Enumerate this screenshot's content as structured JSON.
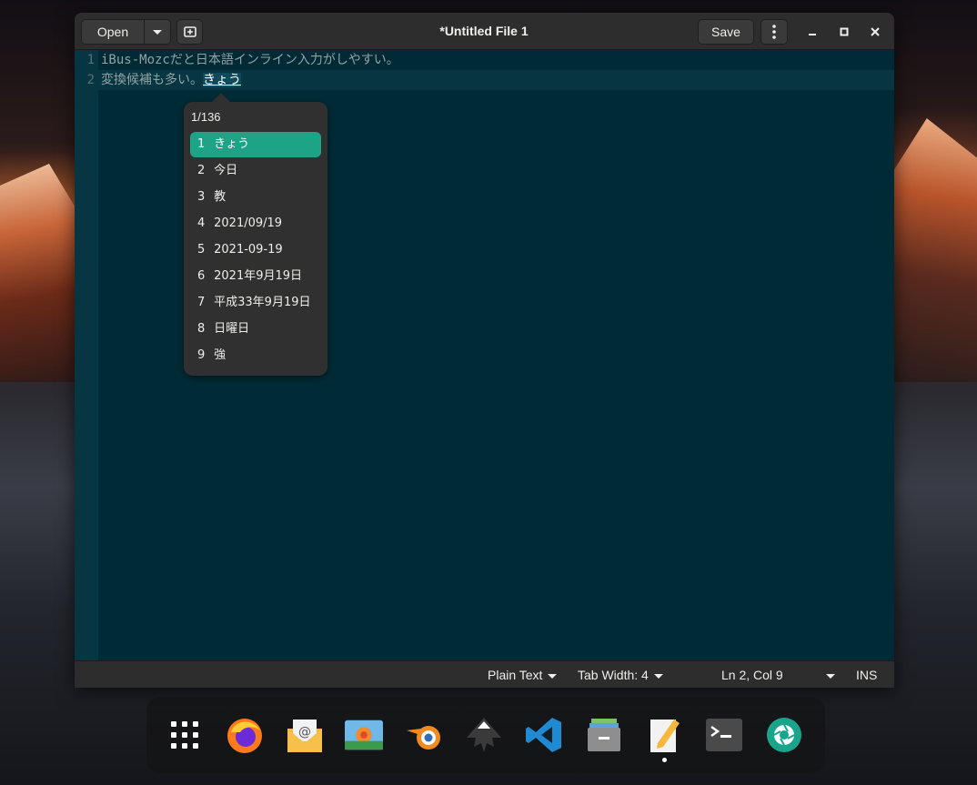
{
  "window": {
    "title": "*Untitled File 1",
    "open_label": "Open",
    "save_label": "Save"
  },
  "editor": {
    "lines": [
      {
        "number": "1",
        "text": "iBus-Mozcだと日本語インライン入力がしやすい。"
      },
      {
        "number": "2",
        "text": "変換候補も多い。",
        "preedit": "きょう"
      }
    ]
  },
  "candidates": {
    "page": "1/136",
    "items": [
      {
        "num": "1",
        "text": "きょう",
        "selected": true
      },
      {
        "num": "2",
        "text": "今日"
      },
      {
        "num": "3",
        "text": "教"
      },
      {
        "num": "4",
        "text": "2021/09/19"
      },
      {
        "num": "5",
        "text": "2021-09-19"
      },
      {
        "num": "6",
        "text": "2021年9月19日"
      },
      {
        "num": "7",
        "text": "平成33年9月19日"
      },
      {
        "num": "8",
        "text": "日曜日"
      },
      {
        "num": "9",
        "text": "強"
      }
    ]
  },
  "statusbar": {
    "language": "Plain Text",
    "tab_width": "Tab Width: 4",
    "position": "Ln 2, Col 9",
    "mode": "INS"
  },
  "dock": {
    "apps": [
      "app-grid-icon",
      "firefox-icon",
      "mail-icon",
      "image-viewer-icon",
      "blender-icon",
      "inkscape-icon",
      "vscode-icon",
      "files-icon",
      "text-editor-icon",
      "terminal-icon",
      "camera-icon"
    ]
  },
  "colors": {
    "editor_bg": "#002b36",
    "gutter_bg": "#073642",
    "accent": "#1da385"
  }
}
